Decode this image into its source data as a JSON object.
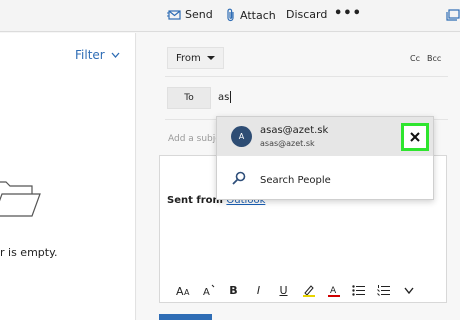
{
  "toolbar": {
    "send_label": "Send",
    "attach_label": "Attach",
    "discard_label": "Discard",
    "more_label": "•••"
  },
  "left_pane": {
    "filter_label": "Filter",
    "empty_text": "r is empty."
  },
  "compose": {
    "from_label": "From",
    "cc_label": "Cc",
    "bcc_label": "Bcc",
    "to_label": "To",
    "to_value": "as",
    "subject_placeholder": "Add a subject",
    "signature_prefix": "Sent from ",
    "signature_link": "Outlook"
  },
  "autocomplete": {
    "suggestion": {
      "initial": "A",
      "name": "asas@azet.sk",
      "email": "asas@azet.sk"
    },
    "search_people_label": "Search People"
  },
  "formatting": {
    "font_size_label": "AA",
    "superscript_label": "A",
    "bold_label": "B",
    "italic_label": "I",
    "underline_label": "U",
    "highlight_label": "A",
    "font_color_label": "A"
  },
  "colors": {
    "accent": "#2f6db5",
    "highlight_outline": "#2ee52e",
    "avatar_bg": "#2e4d74"
  }
}
